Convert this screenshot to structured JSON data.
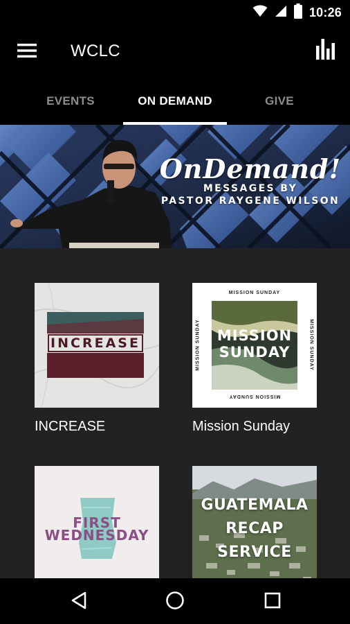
{
  "status_bar": {
    "time": "10:26",
    "icons": [
      "wifi-icon",
      "cell-signal-icon",
      "battery-icon"
    ]
  },
  "app_bar": {
    "title": "WCLC",
    "menu_icon": "hamburger-menu-icon",
    "action_icon": "bar-chart-icon"
  },
  "tabs": [
    {
      "label": "EVENTS",
      "active": false
    },
    {
      "label": "ON DEMAND",
      "active": true
    },
    {
      "label": "GIVE",
      "active": false
    }
  ],
  "banner": {
    "script_title": "OnDemand!",
    "line1": "MESSAGES BY",
    "line2": "PASTOR RAYGENE WILSON"
  },
  "series": [
    {
      "label": "INCREASE",
      "art_text": "INCREASE"
    },
    {
      "label": "Mission Sunday",
      "art_text_line1": "MISSION",
      "art_text_line2": "SUNDAY",
      "frame_text": "MISSION SUNDAY"
    },
    {
      "label": "",
      "art_text_line1": "FIRST",
      "art_text_line2": "WEDNESDAY"
    },
    {
      "label": "",
      "art_text_line1": "GUATEMALA",
      "art_text_line2": "RECAP",
      "art_text_line3": "SERVICE"
    }
  ],
  "nav_bar": {
    "icons": [
      "back-triangle-icon",
      "home-circle-icon",
      "recents-square-icon"
    ]
  },
  "colors": {
    "background": "#000000",
    "grid_background": "#222222",
    "tab_active": "#ffffff",
    "tab_inactive": "#8c8c8c"
  }
}
